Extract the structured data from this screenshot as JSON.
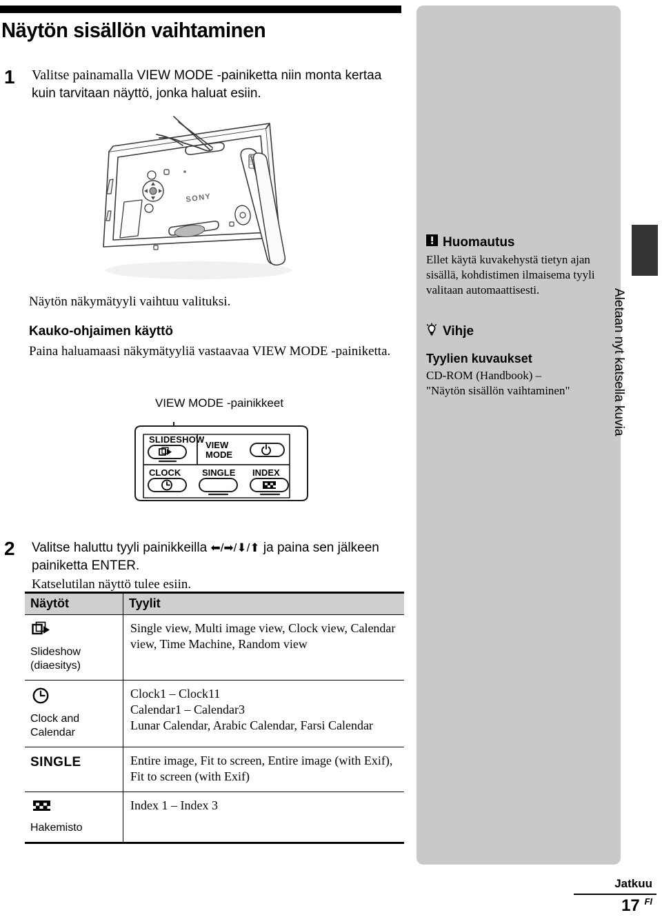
{
  "page": {
    "title": "Näytön sisällön vaihtaminen",
    "footer_continue": "Jatkuu",
    "footer_page": "17",
    "footer_lang": "FI",
    "edge_tab_label": "Aletaan nyt katsella kuvia"
  },
  "steps": [
    {
      "number": "1",
      "text_lead": "Valitse painamalla",
      "text_rest": "VIEW MODE -painiketta niin monta kertaa kuin tarvitaan näyttö, jonka haluat esiin.",
      "result": "Näytön näkymätyyli vaihtuu valituksi.",
      "subheading": "Kauko-ohjaimen käyttö",
      "subtext": "Paina haluamaasi näkymätyyliä vastaavaa VIEW MODE -painiketta.",
      "illustration_caption": "VIEW MODE -painikkeet"
    },
    {
      "number": "2",
      "text": "Valitse haluttu tyyli painikkeilla",
      "arrows": "/ / /",
      "text_after": "ja paina sen jälkeen painiketta ENTER.",
      "result": "Katselutilan näyttö tulee esiin."
    }
  ],
  "remote": {
    "slideshow_label": "SLIDESHOW",
    "viewmode_label_1": "VIEW",
    "viewmode_label_2": "MODE",
    "clock_label": "CLOCK",
    "single_label": "SINGLE",
    "index_label": "INDEX"
  },
  "table": {
    "headers": [
      "Näytöt",
      "Tyylit"
    ],
    "rows": [
      {
        "icon": "slideshow-icon",
        "name_line1": "Slideshow",
        "name_line2": "(diaesitys)",
        "name_bold": false,
        "styles": "Single view, Multi image view, Clock view, Calendar view, Time Machine, Random view"
      },
      {
        "icon": "clock-icon",
        "name_line1": "Clock and",
        "name_line2": "Calendar",
        "name_bold": false,
        "styles": "Clock1 – Clock11\nCalendar1 – Calendar3\nLunar Calendar, Arabic Calendar, Farsi Calendar"
      },
      {
        "icon": "none",
        "name_line1": "SINGLE",
        "name_line2": "",
        "name_bold": true,
        "styles": "Entire image, Fit to screen, Entire image (with Exif), Fit to screen (with Exif)"
      },
      {
        "icon": "index-icon",
        "name_line1": "Hakemisto",
        "name_line2": "",
        "name_bold": false,
        "styles": "Index 1 – Index 3"
      }
    ]
  },
  "sidebar": {
    "note_title": "Huomautus",
    "note_body": "Ellet käytä kuvakehystä tietyn ajan sisällä, kohdistimen ilmaisema tyyli valitaan automaattisesti.",
    "tip_title": "Vihje",
    "tip_subtitle": "Tyylien kuvaukset",
    "tip_body_line1": "CD-ROM (Handbook) –",
    "tip_body_line2": "\"Näytön sisällön vaihtaminen\""
  },
  "colors": {
    "panel_gray": "#c9c9c9",
    "header_gray": "#cfcfcf",
    "tab_dark": "#333333",
    "ink": "#000000"
  }
}
